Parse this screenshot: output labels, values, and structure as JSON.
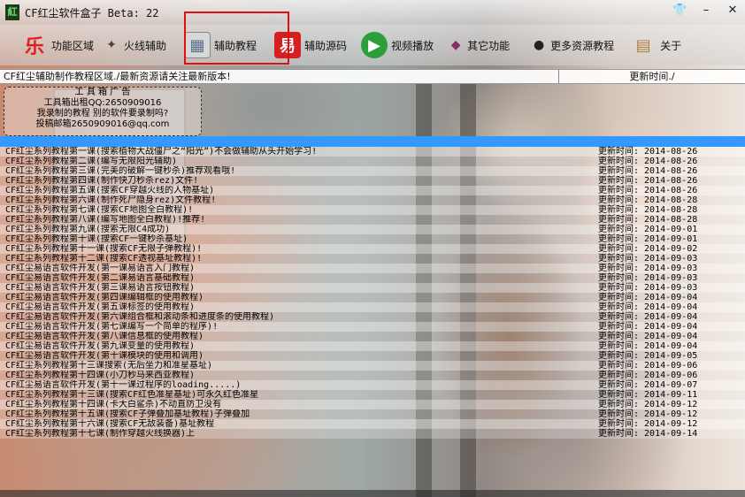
{
  "window": {
    "title": "CF红尘软件盒子  Beta: 22",
    "app_icon_label": "紅"
  },
  "toolbar": {
    "items": [
      {
        "label": "功能区域",
        "icon": "le-logo-icon",
        "glyph": "乐",
        "color": "#e02020"
      },
      {
        "label": "火线辅助",
        "icon": "gun-icon",
        "glyph": "✦",
        "color": "#444444"
      },
      {
        "label": "辅助教程",
        "icon": "film-reel-icon",
        "glyph": "▦",
        "color": "#5a6e8c"
      },
      {
        "label": "辅助源码",
        "icon": "source-code-icon",
        "glyph": "易",
        "color": "#d42020"
      },
      {
        "label": "视频播放",
        "icon": "play-icon",
        "glyph": "▶",
        "color": "#2e9e3a"
      },
      {
        "label": "其它功能",
        "icon": "gamepad-icon",
        "glyph": "◆",
        "color": "#8a2a6a"
      },
      {
        "label": "更多资源教程",
        "icon": "qq-penguin-icon",
        "glyph": "●",
        "color": "#222222"
      },
      {
        "label": "关于",
        "icon": "scroll-icon",
        "glyph": "▤",
        "color": "#b08040"
      }
    ]
  },
  "table": {
    "header_left": "CF红尘辅助制作教程区域./最新资源请关注最新版本!",
    "header_right": "更新时间./"
  },
  "ad": {
    "line1": "工 具 箱 广 告",
    "line2": "工具箱出租QQ:2650909016",
    "line3": "我录制的教程 别的软件要录制吗?",
    "line4": "投稿邮箱2650909016@qq.com"
  },
  "rows": [
    {
      "title": "CF红尘系列教程第一课(搜索植物大战僵尸之“阳光”)不会做辅助从头开始学习!",
      "date": "更新时间: 2014-08-26"
    },
    {
      "title": "CF红尘系列教程第二课(编写无限阳光辅助)",
      "date": "更新时间: 2014-08-26"
    },
    {
      "title": "CF红尘系列教程第三课(完美的破解一键秒杀)推荐观看哦!",
      "date": "更新时间: 2014-08-26"
    },
    {
      "title": "CF红尘系列教程第四课(制作快刀秒杀rez)文件!",
      "date": "更新时间: 2014-08-26"
    },
    {
      "title": "CF红尘系列教程第五课(搜索CF穿越火线的人物基址)",
      "date": "更新时间: 2014-08-26"
    },
    {
      "title": "CF红尘系列教程第六课(制作死尸隐身rez)文件教程!",
      "date": "更新时间: 2014-08-28"
    },
    {
      "title": "CF红尘系列教程第七课(搜索CF地图全白教程)!",
      "date": "更新时间: 2014-08-28"
    },
    {
      "title": "CF红尘系列教程第八课(编写地图全白教程)!推荐!",
      "date": "更新时间: 2014-08-28"
    },
    {
      "title": "CF红尘系列教程第九课(搜索无限C4成功)",
      "date": "更新时间: 2014-09-01"
    },
    {
      "title": "CF红尘系列教程第十课(搜索CF一键秒杀基址)",
      "date": "更新时间: 2014-09-01"
    },
    {
      "title": "CF红尘系列教程第十一课(搜索CF无限子弹教程)!",
      "date": "更新时间: 2014-09-02"
    },
    {
      "title": "CF红尘系列教程第十二课(搜索CF透视基址教程)!",
      "date": "更新时间: 2014-09-03"
    },
    {
      "title": "CF红尘易语言软件开发(第一课易语言入门教程)",
      "date": "更新时间: 2014-09-03"
    },
    {
      "title": "CF红尘易语言软件开发(第二课易语言基础教程)",
      "date": "更新时间: 2014-09-03"
    },
    {
      "title": "CF红尘易语言软件开发(第三课易语言按钮教程)",
      "date": "更新时间: 2014-09-03"
    },
    {
      "title": "CF红尘易语言软件开发(第四课编辑框的使用教程)",
      "date": "更新时间: 2014-09-04"
    },
    {
      "title": "CF红尘易语言软件开发(第五课标签的使用教程)",
      "date": "更新时间: 2014-09-04"
    },
    {
      "title": "CF红尘易语言软件开发(第六课组合框和滚动条和进度条的使用教程)",
      "date": "更新时间: 2014-09-04"
    },
    {
      "title": "CF红尘易语言软件开发(第七课编写一个简单的程序)!",
      "date": "更新时间: 2014-09-04"
    },
    {
      "title": "CF红尘易语言软件开发(第八课信息框的使用教程)",
      "date": "更新时间: 2014-09-04"
    },
    {
      "title": "CF红尘易语言软件开发(第九课变量的使用教程)",
      "date": "更新时间: 2014-09-04"
    },
    {
      "title": "CF红尘易语言软件开发(第十课模块的使用和调用)",
      "date": "更新时间: 2014-09-05"
    },
    {
      "title": "CF红尘系列教程第十三课搜索(无后坐力和准星基址)",
      "date": "更新时间: 2014-09-06"
    },
    {
      "title": "CF红尘系列教程第十四课(小刀秒马来西亚教程)",
      "date": "更新时间: 2014-09-06"
    },
    {
      "title": "CF红尘易语言软件开发(第十一课过程序的loading.....)",
      "date": "更新时间: 2014-09-07"
    },
    {
      "title": "CF红尘系列教程第十三课(搜索CF红色准星基址)可永久红色准星",
      "date": "更新时间: 2014-09-11"
    },
    {
      "title": "CF红尘系列教程第十四课(卡大白鲨杀)不动直防卫没有",
      "date": "更新时间: 2014-09-12"
    },
    {
      "title": "CF红尘系列教程第十五课(搜索CF子弹叠加基址教程)子弹叠加",
      "date": "更新时间: 2014-09-12"
    },
    {
      "title": "CF红尘系列教程第十六课(搜索CF无敌装备)基址教程",
      "date": "更新时间: 2014-09-12"
    },
    {
      "title": "CF红尘系列教程第十七课(制作穿越火线换器)上",
      "date": "更新时间: 2014-09-14"
    }
  ]
}
